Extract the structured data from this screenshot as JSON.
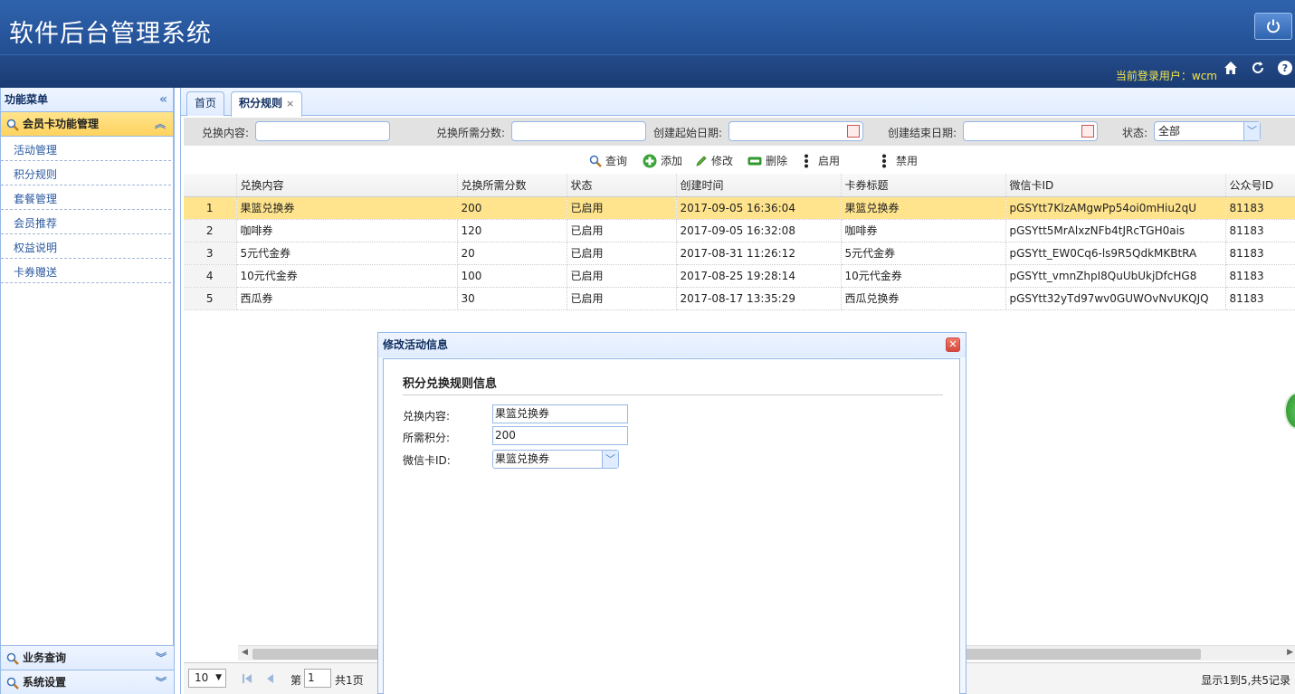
{
  "app": {
    "title": "软件后台管理系统",
    "user_line": "当前登录用户：wcm"
  },
  "sidebar": {
    "title": "功能菜单",
    "active_group": "会员卡功能管理",
    "items": [
      "活动管理",
      "积分规则",
      "套餐管理",
      "会员推荐",
      "权益说明",
      "卡券赠送"
    ],
    "bottom_groups": [
      "业务查询",
      "系统设置"
    ]
  },
  "tabs": [
    {
      "label": "首页"
    },
    {
      "label": "积分规则",
      "close": "×"
    }
  ],
  "filter": {
    "content_label": "兑换内容:",
    "points_label": "兑换所需分数:",
    "start_label": "创建起始日期:",
    "end_label": "创建结束日期:",
    "status_label": "状态:",
    "status_value": "全部"
  },
  "toolbar": {
    "query": "查询",
    "add": "添加",
    "edit": "修改",
    "delete": "删除",
    "enable": "启用",
    "disable": "禁用"
  },
  "table": {
    "headers": [
      "兑换内容",
      "兑换所需分数",
      "状态",
      "创建时间",
      "卡券标题",
      "微信卡ID",
      "公众号ID"
    ],
    "rows": [
      [
        "1",
        "果篮兑换券",
        "200",
        "已启用",
        "2017-09-05 16:36:04",
        "果篮兑换券",
        "pGSYtt7KlzAMgwPp54oi0mHiu2qU",
        "81183"
      ],
      [
        "2",
        "咖啡券",
        "120",
        "已启用",
        "2017-09-05 16:32:08",
        "咖啡券",
        "pGSYtt5MrAlxzNFb4tJRcTGH0ais",
        "81183"
      ],
      [
        "3",
        "5元代金券",
        "20",
        "已启用",
        "2017-08-31 11:26:12",
        "5元代金券",
        "pGSYtt_EW0Cq6-ls9R5QdkMKBtRA",
        "81183"
      ],
      [
        "4",
        "10元代金券",
        "100",
        "已启用",
        "2017-08-25 19:28:14",
        "10元代金券",
        "pGSYtt_vmnZhpI8QuUbUkjDfcHG8",
        "81183"
      ],
      [
        "5",
        "西瓜券",
        "30",
        "已启用",
        "2017-08-17 13:35:29",
        "西瓜兑换券",
        "pGSYtt32yTd97wv0GUWOvNvUKQJQ",
        "81183"
      ]
    ]
  },
  "pager": {
    "page_size": "10",
    "page_prefix": "第",
    "page_value": "1",
    "page_suffix": "共1页",
    "summary": "显示1到5,共5记录"
  },
  "dialog": {
    "title": "修改活动信息",
    "section_title": "积分兑换规则信息",
    "content_label": "兑换内容:",
    "content_value": "果篮兑换券",
    "points_label": "所需积分:",
    "points_value": "200",
    "card_label": "微信卡ID:",
    "card_value": "果篮兑换券"
  },
  "colors": {
    "header": "#2f63ad",
    "accent": "#ffe48d",
    "border": "#95b8e7",
    "user_text": "#f4e64a"
  }
}
